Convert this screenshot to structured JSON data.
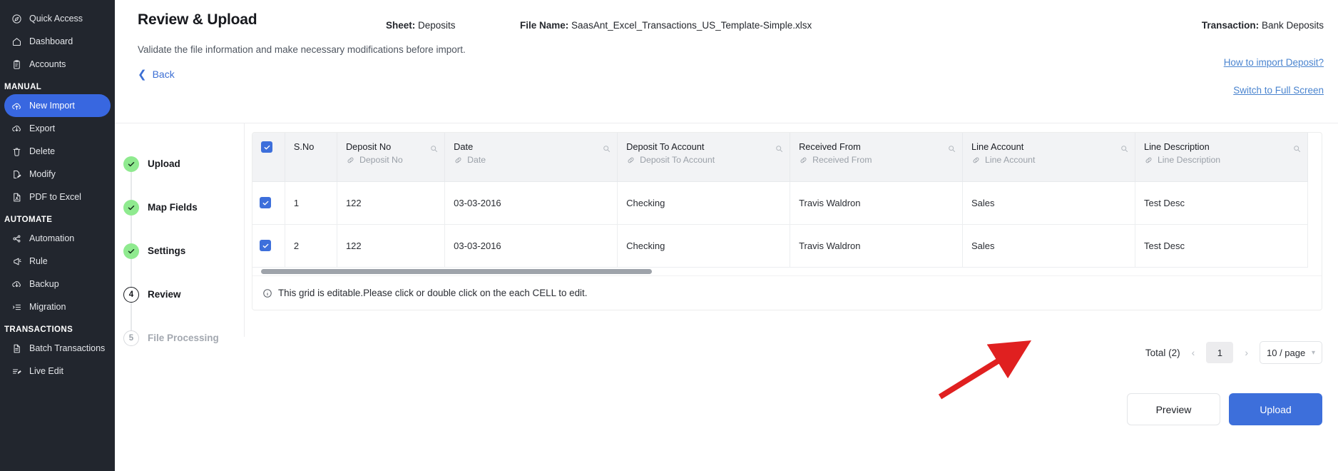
{
  "sidebar": {
    "items": [
      {
        "label": "Quick Access",
        "icon": "compass-icon",
        "type": "item",
        "active": false
      },
      {
        "label": "Dashboard",
        "icon": "home-icon",
        "type": "item",
        "active": false
      },
      {
        "label": "Accounts",
        "icon": "clipboard-icon",
        "type": "item",
        "active": false
      },
      {
        "label": "MANUAL",
        "type": "group"
      },
      {
        "label": "New Import",
        "icon": "upload-cloud-icon",
        "type": "item",
        "active": true
      },
      {
        "label": "Export",
        "icon": "download-cloud-icon",
        "type": "item",
        "active": false
      },
      {
        "label": "Delete",
        "icon": "trash-icon",
        "type": "item",
        "active": false
      },
      {
        "label": "Modify",
        "icon": "file-edit-icon",
        "type": "item",
        "active": false
      },
      {
        "label": "PDF to Excel",
        "icon": "pdf-file-icon",
        "type": "item",
        "active": false
      },
      {
        "label": "AUTOMATE",
        "type": "group"
      },
      {
        "label": "Automation",
        "icon": "share-nodes-icon",
        "type": "item",
        "active": false
      },
      {
        "label": "Rule",
        "icon": "megaphone-icon",
        "type": "item",
        "active": false
      },
      {
        "label": "Backup",
        "icon": "download-cloud-icon",
        "type": "item",
        "active": false
      },
      {
        "label": "Migration",
        "icon": "list-arrow-icon",
        "type": "item",
        "active": false
      },
      {
        "label": "TRANSACTIONS",
        "type": "group"
      },
      {
        "label": "Batch Transactions",
        "icon": "document-icon",
        "type": "item",
        "active": false
      },
      {
        "label": "Live Edit",
        "icon": "pencil-lines-icon",
        "type": "item",
        "active": false
      }
    ]
  },
  "header": {
    "title": "Review & Upload",
    "subtitle": "Validate the file information and make necessary modifications before import.",
    "back_label": "Back",
    "sheet_label": "Sheet:",
    "sheet_value": "Deposits",
    "file_label": "File Name:",
    "file_value": "SaasAnt_Excel_Transactions_US_Template-Simple.xlsx",
    "transaction_label": "Transaction:",
    "transaction_value": "Bank Deposits",
    "link_how": "How to import Deposit?",
    "link_fullscreen": "Switch to Full Screen"
  },
  "stepper": {
    "steps": [
      {
        "label": "Upload",
        "state": "done",
        "number": "1"
      },
      {
        "label": "Map Fields",
        "state": "done",
        "number": "2"
      },
      {
        "label": "Settings",
        "state": "done",
        "number": "3"
      },
      {
        "label": "Review",
        "state": "current",
        "number": "4"
      },
      {
        "label": "File Processing",
        "state": "todo",
        "number": "5"
      }
    ]
  },
  "grid": {
    "columns": [
      {
        "name": "S.No",
        "mapped": null,
        "searchable": false
      },
      {
        "name": "Deposit No",
        "mapped": "Deposit No",
        "searchable": true
      },
      {
        "name": "Date",
        "mapped": "Date",
        "searchable": true
      },
      {
        "name": "Deposit To Account",
        "mapped": "Deposit To Account",
        "searchable": true
      },
      {
        "name": "Received From",
        "mapped": "Received From",
        "searchable": true
      },
      {
        "name": "Line Account",
        "mapped": "Line Account",
        "searchable": true
      },
      {
        "name": "Line Description",
        "mapped": "Line Description",
        "searchable": true
      }
    ],
    "header_checkbox_checked": true,
    "rows": [
      {
        "checked": true,
        "sno": "1",
        "deposit_no": "122",
        "date": "03-03-2016",
        "deposit_to_account": "Checking",
        "received_from": "Travis Waldron",
        "line_account": "Sales",
        "line_description": "Test Desc"
      },
      {
        "checked": true,
        "sno": "2",
        "deposit_no": "122",
        "date": "03-03-2016",
        "deposit_to_account": "Checking",
        "received_from": "Travis Waldron",
        "line_account": "Sales",
        "line_description": "Test Desc"
      }
    ],
    "notice": "This grid is editable.Please click or double click on the each CELL to edit."
  },
  "pagination": {
    "total": "Total (2)",
    "prev": "‹",
    "page": "1",
    "next": "›",
    "page_size": "10 / page"
  },
  "footer": {
    "preview_label": "Preview",
    "upload_label": "Upload"
  },
  "colors": {
    "accent": "#3d6fdb",
    "sidebar_bg": "#22262e",
    "step_done": "#8fea8f",
    "link": "#4a84cf",
    "annotation_arrow": "#e02020"
  }
}
